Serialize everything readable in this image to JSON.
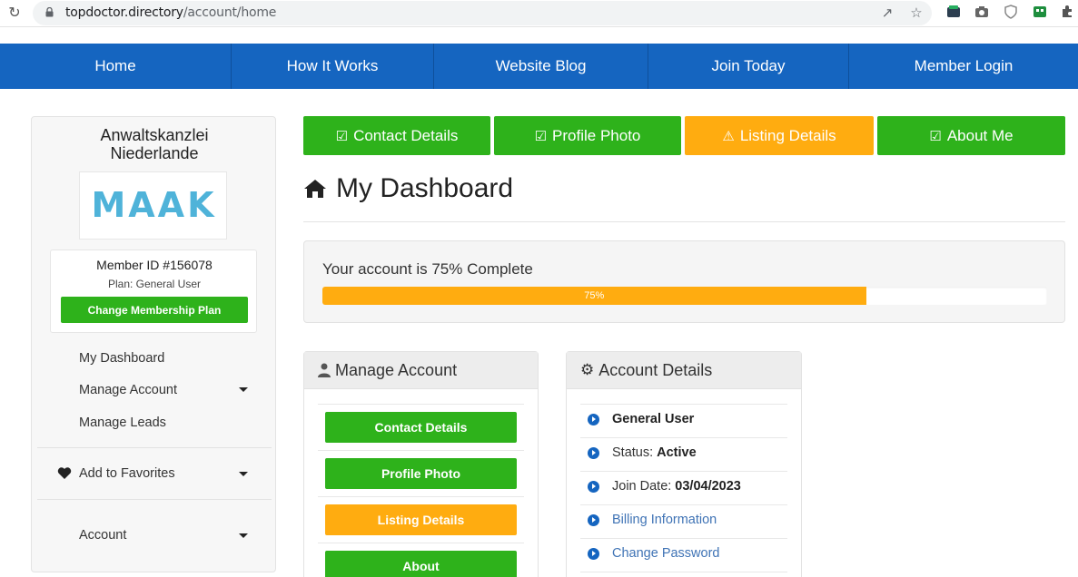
{
  "browser": {
    "url_host": "topdoctor.directory",
    "url_path": "/account/home"
  },
  "nav": {
    "items": [
      "Home",
      "How It Works",
      "Website Blog",
      "Join Today",
      "Member Login"
    ]
  },
  "sidebar": {
    "org_name": "Anwaltskanzlei Niederlande",
    "logo_text": "MAAK",
    "member_id": "Member ID #156078",
    "plan": "Plan: General User",
    "change_plan": "Change Membership Plan",
    "links": {
      "dashboard": "My Dashboard",
      "manage_account": "Manage Account",
      "manage_leads": "Manage Leads",
      "favorites": "Add to Favorites",
      "account": "Account"
    }
  },
  "steps": [
    {
      "label": "Contact Details",
      "status": "done",
      "color": "#2eb21b"
    },
    {
      "label": "Profile Photo",
      "status": "done",
      "color": "#2eb21b"
    },
    {
      "label": "Listing Details",
      "status": "warning",
      "color": "#ffac10"
    },
    {
      "label": "About Me",
      "status": "done",
      "color": "#2eb21b"
    }
  ],
  "dashboard": {
    "title": "My Dashboard",
    "progress_text": "Your account is 75% Complete",
    "progress_value": 0.75,
    "progress_label": "75%"
  },
  "manage_account": {
    "title": "Manage Account",
    "buttons": [
      "Contact Details",
      "Profile Photo",
      "Listing Details",
      "About"
    ]
  },
  "account_details": {
    "title": "Account Details",
    "plan": "General User",
    "status_label": "Status:",
    "status_value": "Active",
    "join_label": "Join Date:",
    "join_value": "03/04/2023",
    "billing": "Billing Information",
    "password": "Change Password"
  },
  "colors": {
    "nav": "#1565c0",
    "green": "#2eb21b",
    "orange": "#ffac10"
  }
}
